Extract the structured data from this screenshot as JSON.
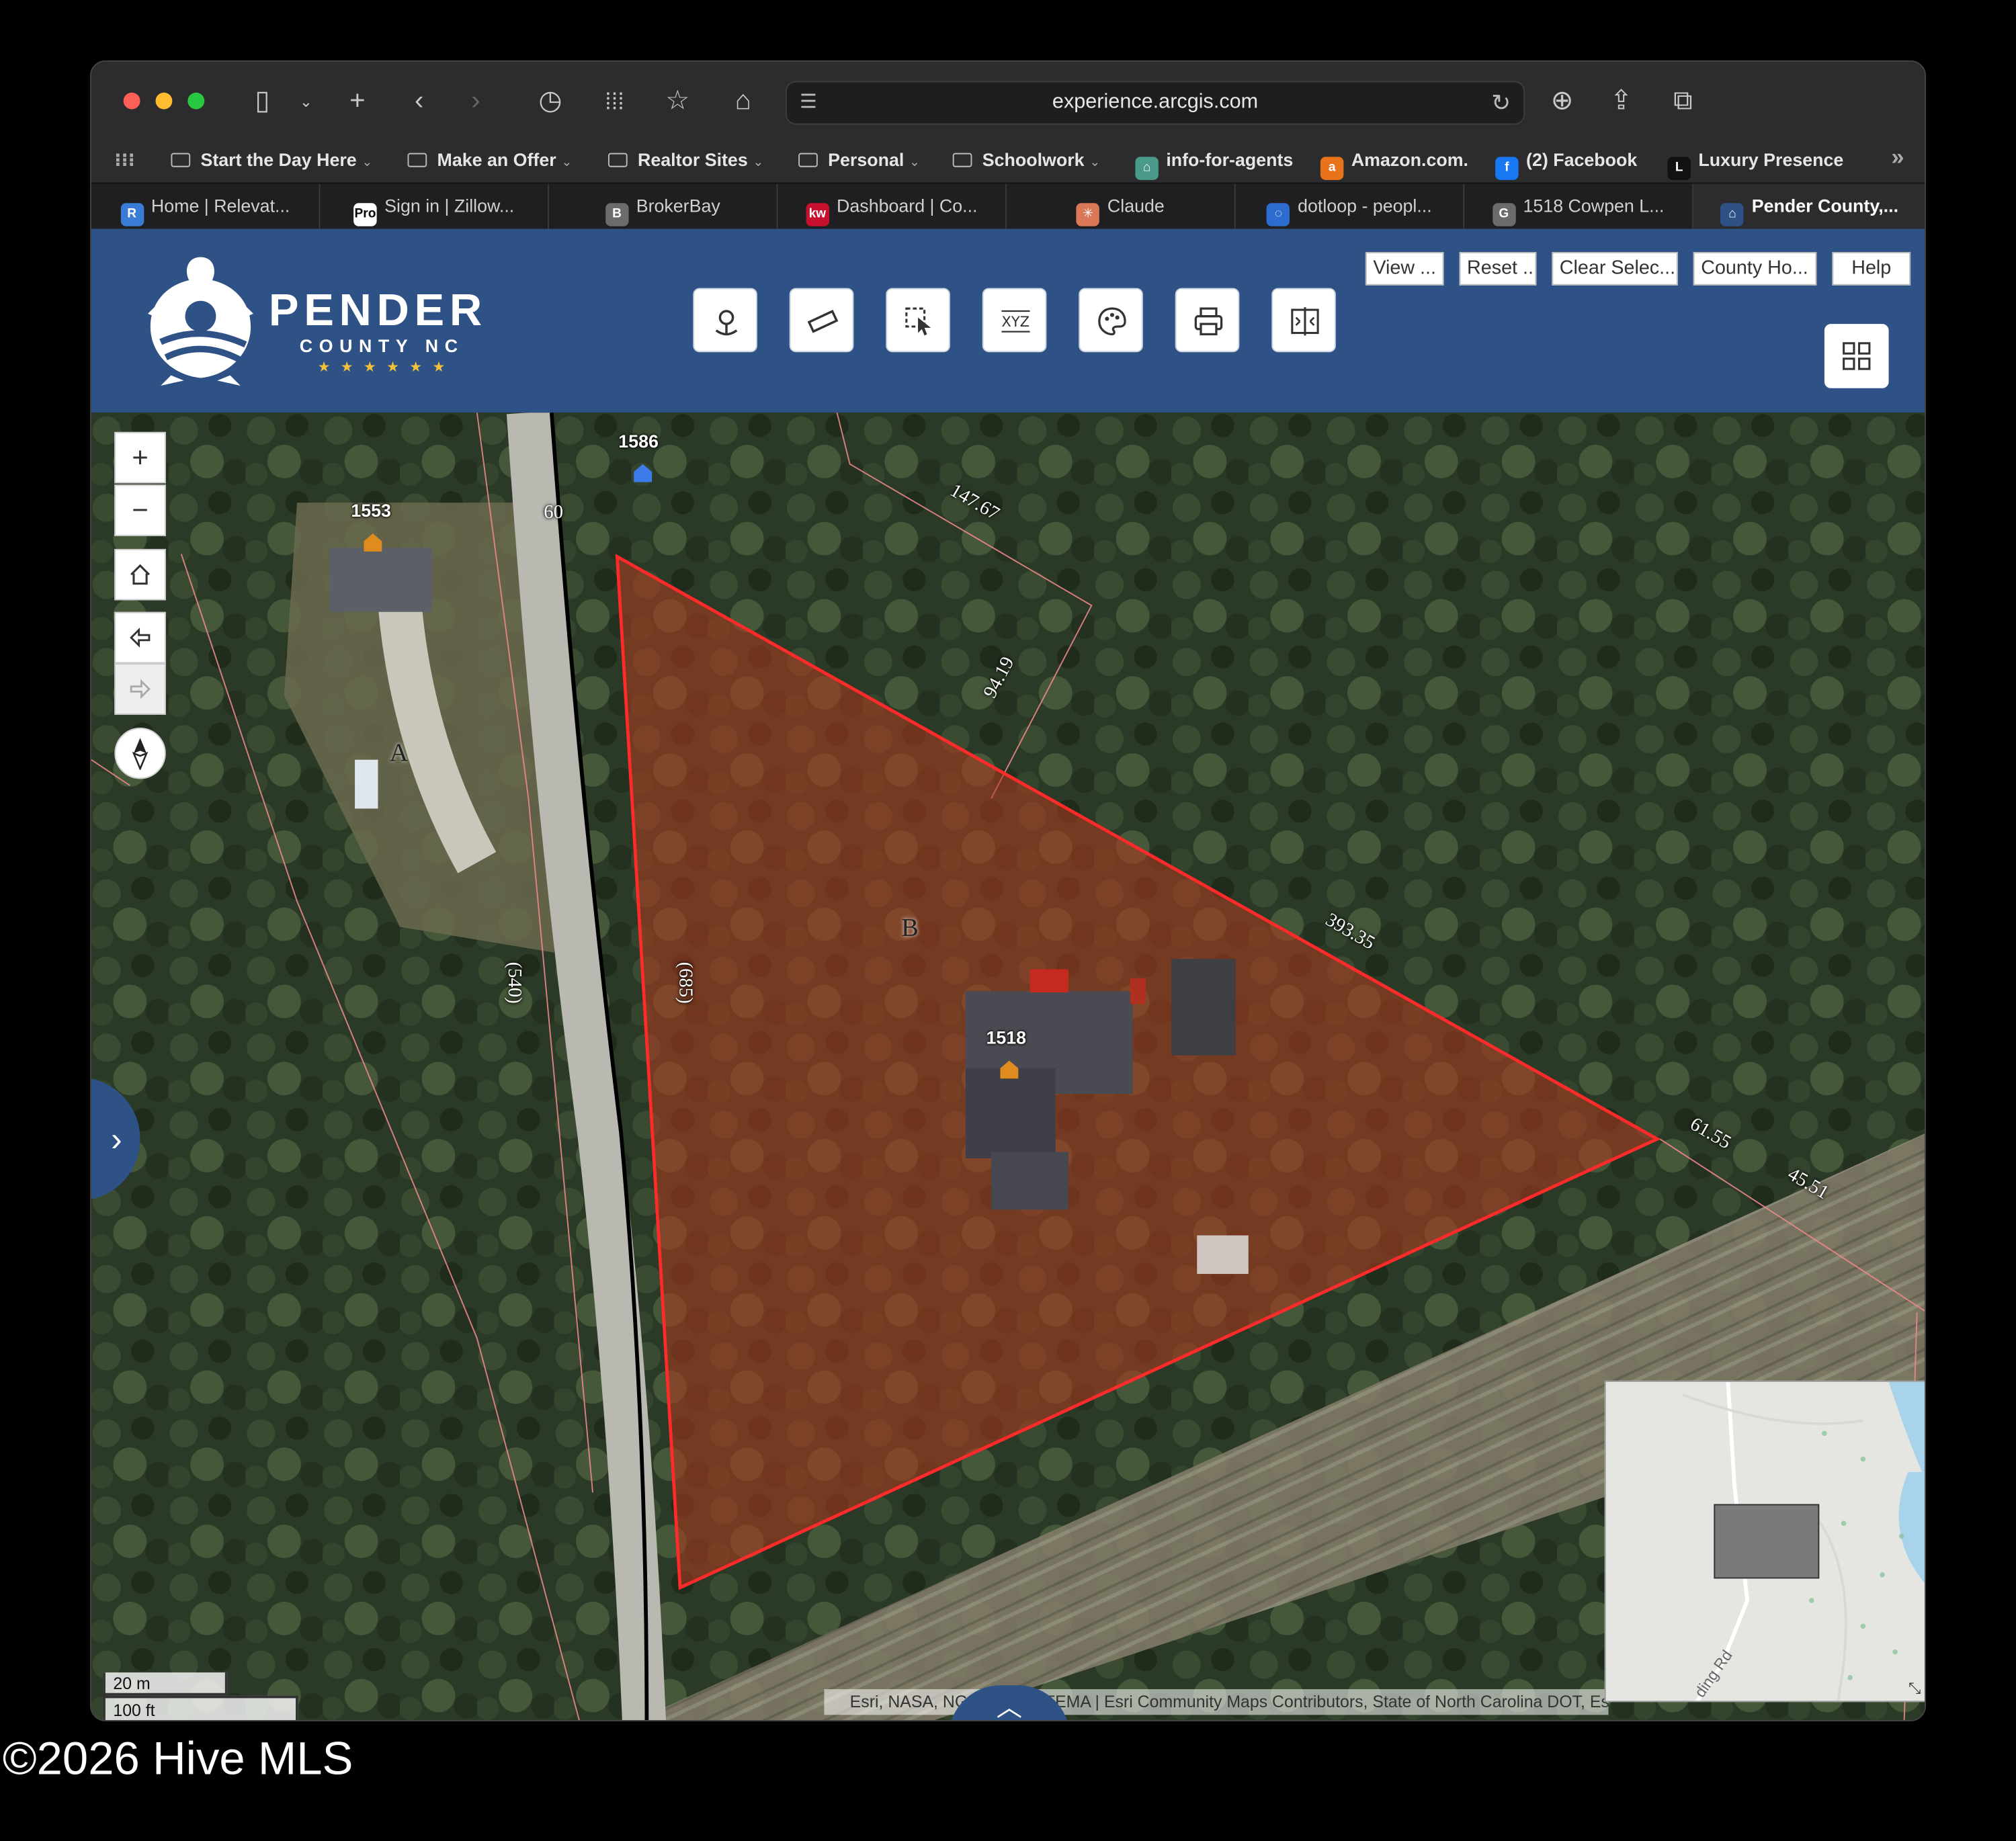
{
  "browser": {
    "url": "experience.arcgis.com",
    "bookmarks": [
      {
        "label": "Start the Day Here",
        "folder": true
      },
      {
        "label": "Make an Offer",
        "folder": true
      },
      {
        "label": "Realtor Sites",
        "folder": true
      },
      {
        "label": "Personal",
        "folder": true
      },
      {
        "label": "Schoolwork",
        "folder": true
      },
      {
        "label": "info-for-agents",
        "folder": false
      },
      {
        "label": "Amazon.com.",
        "folder": false
      },
      {
        "label": "(2) Facebook",
        "folder": false
      },
      {
        "label": "Luxury Presence",
        "folder": false
      }
    ],
    "tabs": [
      {
        "label": "Home | Relevat...",
        "icon": "R",
        "color": "#3a7bd5"
      },
      {
        "label": "Sign in | Zillow...",
        "icon": "Pro",
        "color": "#ffffff"
      },
      {
        "label": "BrokerBay",
        "icon": "B",
        "color": "#6b6b6b"
      },
      {
        "label": "Dashboard | Co...",
        "icon": "kw",
        "color": "#c8102e"
      },
      {
        "label": "Claude",
        "icon": "✳",
        "color": "#d97757"
      },
      {
        "label": "dotloop - peopl...",
        "icon": "◌",
        "color": "#2d6ccf"
      },
      {
        "label": "1518 Cowpen L...",
        "icon": "G",
        "color": "#6b6b6b"
      },
      {
        "label": "Pender County,...",
        "icon": "⌂",
        "color": "#2f5286"
      }
    ]
  },
  "app": {
    "logo_title": "PENDER",
    "logo_subtitle": "COUNTY NC",
    "logo_stars": "★★★★★★",
    "header_buttons": [
      "View ...",
      "Reset ...",
      "Clear Selec...",
      "County Ho...",
      "Help"
    ],
    "tools": [
      "locate-tool",
      "measure-tool",
      "select-tool",
      "coordinate-tool",
      "basemap-tool",
      "print-tool",
      "swipe-tool"
    ]
  },
  "map": {
    "zoom_in": "+",
    "zoom_out": "−",
    "labels": {
      "p1586": "1586",
      "p1553": "1553",
      "p1518": "1518",
      "road60": "60",
      "A": "A",
      "B": "B"
    },
    "dimensions": {
      "d14767": "147.67",
      "d9419": "94.19",
      "d39335": "393.35",
      "d6155": "61.55",
      "d4551": "45.51",
      "d540": "(540)",
      "d685": "(685)"
    },
    "scale_m": "20 m",
    "scale_ft": "100 ft",
    "attribution": "Esri, NASA, NGA, USGS, FEMA | Esri Community Maps Contributors, State of North Carolina DOT, Es",
    "overview_road": "ding Rd"
  },
  "footer": {
    "copyright": "©2026 Hive MLS"
  }
}
